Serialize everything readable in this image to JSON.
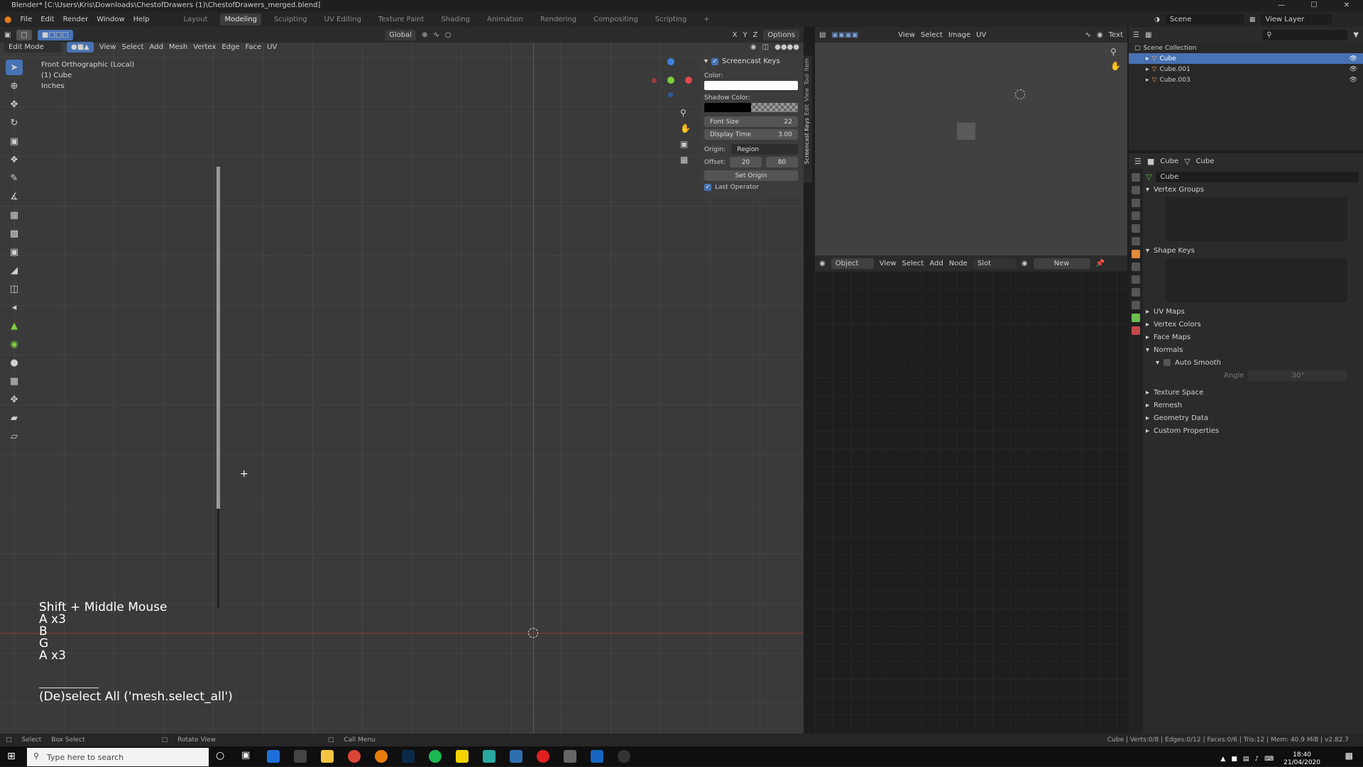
{
  "titlebar": {
    "title": "Blender* [C:\\Users\\Kris\\Downloads\\ChestofDrawers (1)\\ChestofDrawers_merged.blend]"
  },
  "menu": {
    "items": [
      "File",
      "Edit",
      "Render",
      "Window",
      "Help"
    ]
  },
  "workspaces": {
    "items": [
      "Layout",
      "Modeling",
      "Sculpting",
      "UV Editing",
      "Texture Paint",
      "Shading",
      "Animation",
      "Rendering",
      "Compositing",
      "Scripting"
    ],
    "active": "Modeling",
    "add": "+"
  },
  "top_right": {
    "scene": "Scene",
    "view_layer": "View Layer"
  },
  "viewport_header": {
    "mode": "Edit Mode",
    "menus": [
      "View",
      "Select",
      "Add",
      "Mesh",
      "Vertex",
      "Edge",
      "Face",
      "UV"
    ],
    "orientation": "Global",
    "options": "Options",
    "axes": [
      "X",
      "Y",
      "Z"
    ]
  },
  "viewport": {
    "view_name": "Front Orthographic (Local)",
    "object": "(1) Cube",
    "units": "Inches"
  },
  "screencast": {
    "lines": [
      "Shift + Middle Mouse",
      "A x3",
      "B",
      "G",
      "A x3"
    ],
    "operator": "(De)select All ('mesh.select_all')"
  },
  "npanel": {
    "title": "Screencast Keys",
    "color_label": "Color:",
    "shadow_label": "Shadow Color:",
    "font_size_label": "Font Size",
    "font_size": "22",
    "display_time_label": "Display Time",
    "display_time": "3.00",
    "origin_label": "Origin:",
    "origin_value": "Region",
    "offset_label": "Offset:",
    "offset_x": "20",
    "offset_y": "80",
    "set_origin": "Set Origin",
    "last_operator": "Last Operator",
    "tabs": [
      "Item",
      "Tool",
      "View",
      "Edit",
      "Screencast Keys"
    ]
  },
  "image_editor": {
    "menus": [
      "View",
      "Select",
      "Image",
      "UV"
    ],
    "text_tab": "Text"
  },
  "node_editor": {
    "type": "Object",
    "menus": [
      "View",
      "Select",
      "Add",
      "Node"
    ],
    "slot": "Slot",
    "new": "New"
  },
  "outliner": {
    "root": "Scene Collection",
    "items": [
      {
        "name": "Cube",
        "selected": true
      },
      {
        "name": "Cube.001",
        "selected": false
      },
      {
        "name": "Cube.003",
        "selected": false
      }
    ]
  },
  "properties": {
    "object": "Cube",
    "mesh": "Cube",
    "name_field": "Cube",
    "vertex_groups": "Vertex Groups",
    "shape_keys": "Shape Keys",
    "sections": [
      "UV Maps",
      "Vertex Colors",
      "Face Maps",
      "Normals"
    ],
    "auto_smooth": "Auto Smooth",
    "angle_label": "Angle",
    "angle_value": "30°",
    "more_sections": [
      "Texture Space",
      "Remesh",
      "Geometry Data",
      "Custom Properties"
    ]
  },
  "statusbar": {
    "select": "Select",
    "box_select": "Box Select",
    "rotate": "Rotate View",
    "call_menu": "Call Menu",
    "stats": "Cube | Verts:0/8 | Edges:0/12 | Faces:0/6 | Tris:12 | Mem: 40.9 MiB | v2.82.7"
  },
  "taskbar": {
    "search_placeholder": "Type here to search",
    "time": "18:40",
    "date": "21/04/2020"
  },
  "colors": {
    "accent": "#4772b3",
    "x_axis": "#e0474f",
    "y_axis": "#7ccf3a",
    "z_axis": "#3f82e0"
  }
}
